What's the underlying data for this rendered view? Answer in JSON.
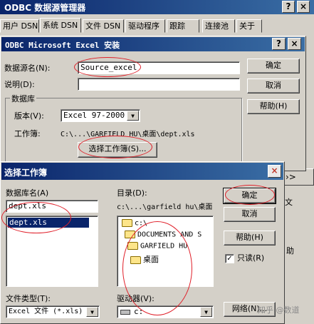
{
  "odbc_admin": {
    "title": "ODBC 数据源管理器",
    "title_buttons": [
      "?",
      "×"
    ],
    "tabs": [
      "用户 DSN",
      "系统 DSN",
      "文件 DSN",
      "驱动程序",
      "跟踪",
      "连接池",
      "关于"
    ],
    "partial_right_labels": [
      "›>",
      "文",
      "助"
    ]
  },
  "excel_setup": {
    "title": "ODBC Microsoft Excel 安装",
    "title_buttons": [
      "?",
      "×"
    ],
    "dsn_label": "数据源名(N):",
    "dsn_value": "Source_excel",
    "desc_label": "说明(D):",
    "desc_value": "",
    "group_label": "数据库",
    "version_label": "版本(V):",
    "version_value": "Excel 97-2000",
    "workbook_label": "工作簿:",
    "workbook_path": "C:\\...\\GARFIELD HU\\桌面\\dept.xls",
    "select_workbook_button": "选择工作簿(S)...",
    "ok_button": "确定",
    "cancel_button": "取消",
    "help_button": "帮助(H)"
  },
  "select_workbook": {
    "title": "选择工作簿",
    "close_button": "×",
    "dbname_label": "数据库名(A)",
    "dbname_value": "dept.xls",
    "file_list": [
      "dept.xls"
    ],
    "dir_label": "目录(D):",
    "dir_path": "c:\\...\\garfield hu\\桌面",
    "tree": [
      "c:\\",
      "DOCUMENTS AND S",
      "GARFIELD HU",
      "桌面"
    ],
    "filetype_label": "文件类型(T):",
    "filetype_value": "Excel 文件 (*.xls)",
    "drive_label": "驱动器(V):",
    "drive_value": "c:",
    "ok_button": "确定",
    "cancel_button": "取消",
    "help_button": "帮助(H)",
    "readonly_label": "只读(R)",
    "readonly_checked": true,
    "network_button": "网络(N)..."
  },
  "watermark": "知乎 @数道",
  "colors": {
    "titlebar_start": "#0a246a",
    "titlebar_end": "#3a6ea5",
    "face": "#d4d0c8",
    "selection": "#0a246a",
    "annotation": "#e0202a"
  }
}
